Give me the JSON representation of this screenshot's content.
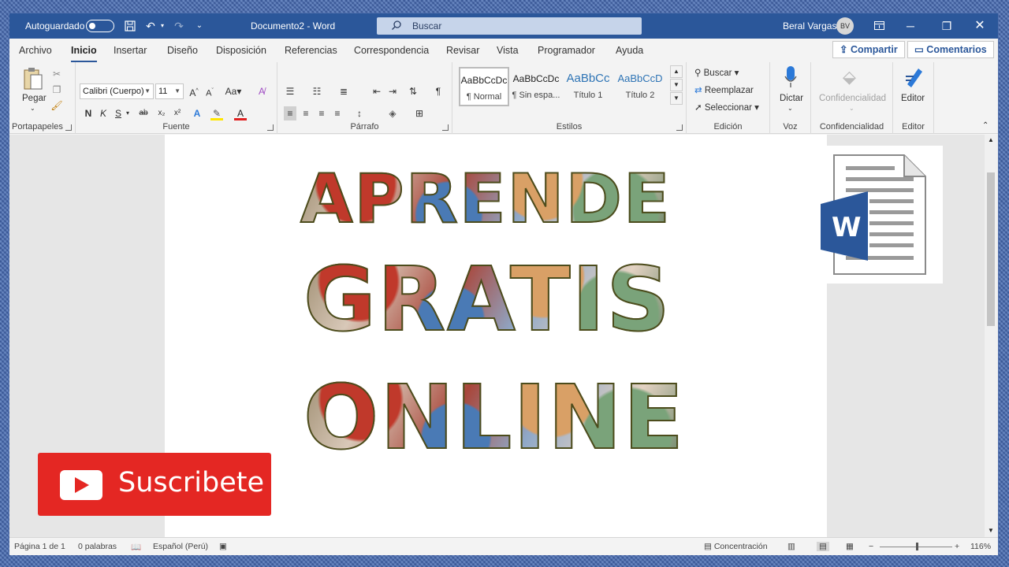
{
  "titlebar": {
    "autosave_label": "Autoguardado",
    "doc_title": "Documento2 - Word",
    "search_label": "Buscar",
    "user_name": "Beral Vargas",
    "user_initials": "BV"
  },
  "tabs": [
    "Archivo",
    "Inicio",
    "Insertar",
    "Diseño",
    "Disposición",
    "Referencias",
    "Correspondencia",
    "Revisar",
    "Vista",
    "Programador",
    "Ayuda"
  ],
  "share_label": "Compartir",
  "comments_label": "Comentarios",
  "ribbon": {
    "clipboard": {
      "paste_label": "Pegar",
      "group_label": "Portapapeles"
    },
    "font": {
      "font_name": "Calibri (Cuerpo)",
      "font_size": "11",
      "bold": "N",
      "italic": "K",
      "underline": "S",
      "change_case": "Aa",
      "group_label": "Fuente"
    },
    "paragraph": {
      "group_label": "Párrafo"
    },
    "styles": {
      "items": [
        {
          "sample": "AaBbCcDc",
          "name": "¶ Normal"
        },
        {
          "sample": "AaBbCcDc",
          "name": "¶ Sin espa..."
        },
        {
          "sample": "AaBbCc",
          "name": "Título 1"
        },
        {
          "sample": "AaBbCcD",
          "name": "Título 2"
        }
      ],
      "group_label": "Estilos"
    },
    "editing": {
      "find": "Buscar",
      "replace": "Reemplazar",
      "select": "Seleccionar",
      "group_label": "Edición"
    },
    "voice": {
      "dictate": "Dictar",
      "group_label": "Voz"
    },
    "sensitivity": {
      "label": "Confidencialidad",
      "group_label": "Confidencialidad"
    },
    "editor": {
      "label": "Editor",
      "group_label": "Editor"
    }
  },
  "document": {
    "line1": "APRENDE",
    "line2": "GRATIS",
    "line3": "ONLINE",
    "logo_letter": "W"
  },
  "overlay": {
    "subscribe": "Suscribete"
  },
  "colors": {
    "word_blue": "#2b579a",
    "youtube_red": "#e42723"
  },
  "statusbar": {
    "page": "Página 1 de 1",
    "words": "0 palabras",
    "language": "Español (Perú)",
    "focus": "Concentración",
    "zoom": "116%"
  }
}
